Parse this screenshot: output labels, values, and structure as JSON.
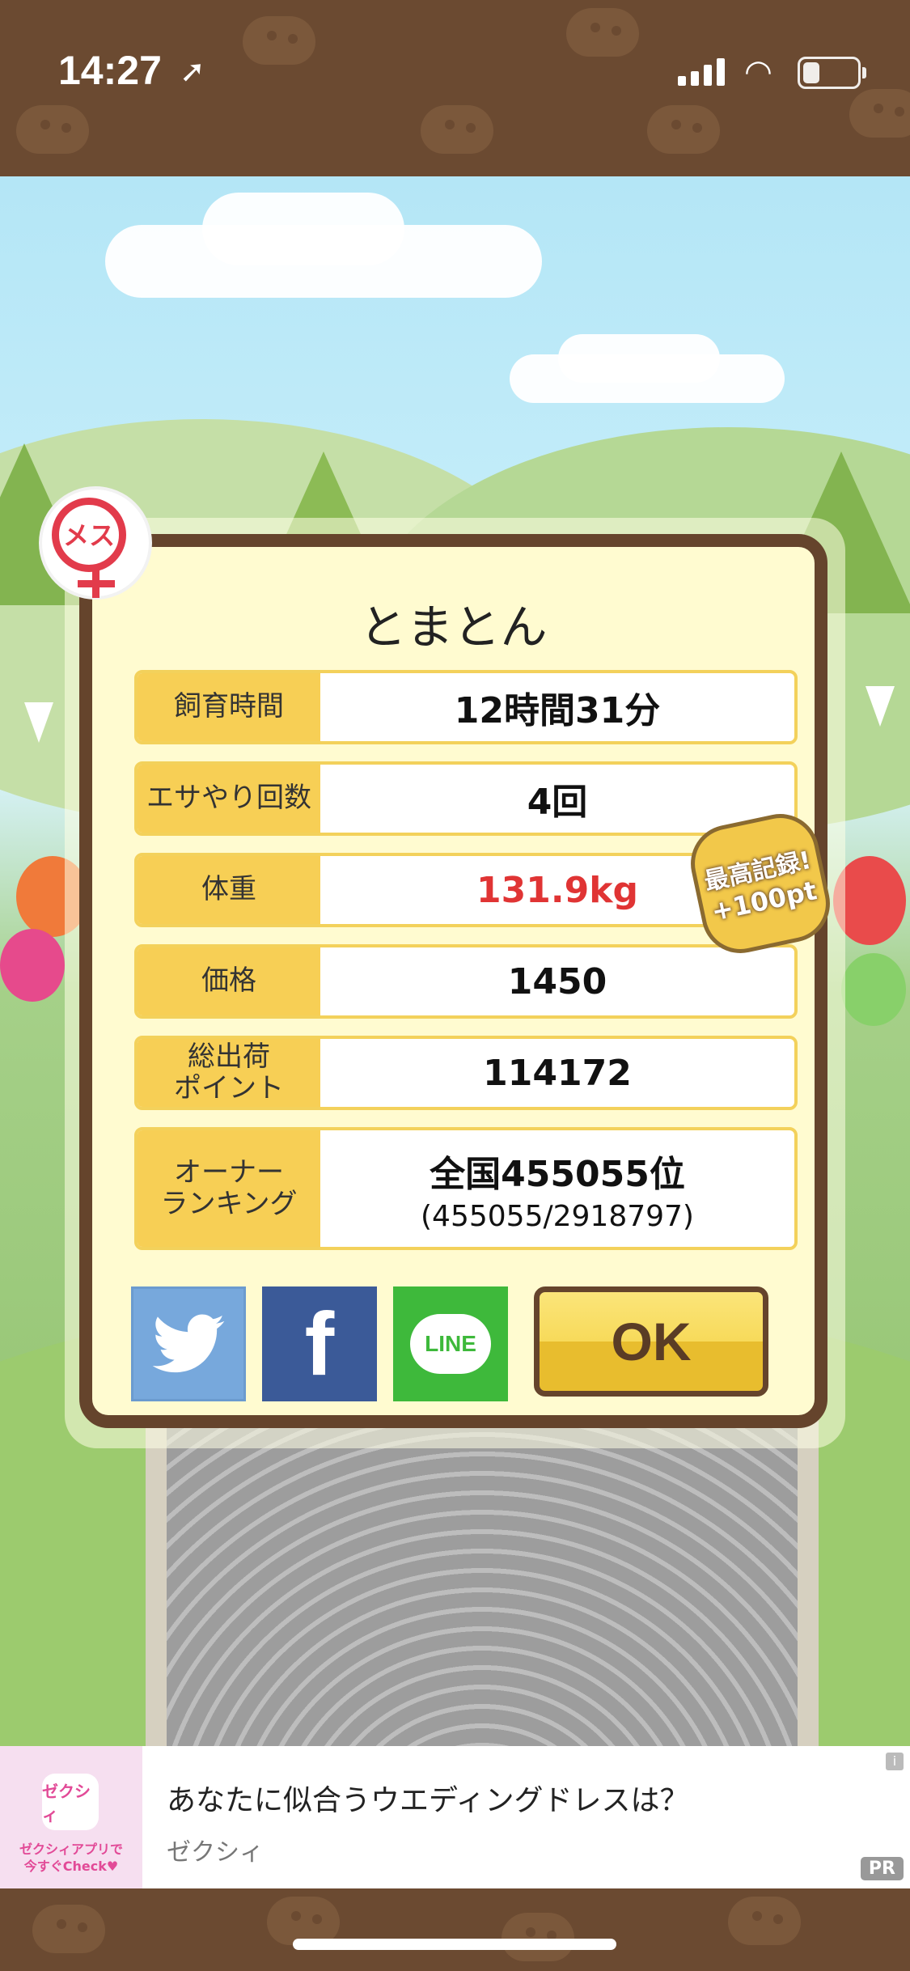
{
  "status_bar": {
    "time": "14:27",
    "location_icon": "location-arrow-icon",
    "signal_icon": "cellular-signal-icon",
    "wifi_icon": "wifi-icon",
    "battery_icon": "battery-low-icon"
  },
  "dialog": {
    "gender_badge": "メス",
    "title": "とまとん",
    "rows": [
      {
        "label": "飼育時間",
        "value": "12時間31分"
      },
      {
        "label": "エサやり回数",
        "value": "4回"
      },
      {
        "label": "体重",
        "value": "131.9kg"
      },
      {
        "label": "価格",
        "value": "1450"
      },
      {
        "label": "総出荷\nポイント",
        "value": "114172"
      },
      {
        "label": "オーナー\nランキング",
        "value": "全国455055位",
        "value_sub": "(455055/2918797)"
      }
    ],
    "record_badge": {
      "line1": "最高記録!",
      "line2": "+100pt"
    },
    "share": {
      "twitter_icon": "twitter-bird-icon",
      "facebook_label": "f",
      "line_label": "LINE"
    },
    "ok_label": "OK"
  },
  "ad": {
    "logo_text": "ゼクシィ",
    "logo_caption": "ゼクシィアプリで\n今すぐCheck♥",
    "title": "あなたに似合うウエディングドレスは？",
    "advertiser": "ゼクシィ",
    "info_label": "i",
    "pr_label": "PR"
  },
  "colors": {
    "accent": "#f7cf55",
    "frame": "#65442c",
    "weight_value": "#e03434"
  }
}
